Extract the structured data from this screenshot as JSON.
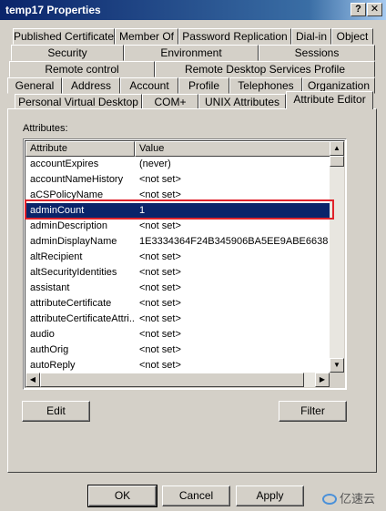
{
  "window": {
    "title": "temp17 Properties",
    "help_label": "?",
    "close_label": "✕"
  },
  "tabs": {
    "row1": [
      "Published Certificates",
      "Member Of",
      "Password Replication",
      "Dial-in",
      "Object"
    ],
    "row2": [
      "Security",
      "Environment",
      "Sessions"
    ],
    "row3": [
      "Remote control",
      "Remote Desktop Services Profile"
    ],
    "row4": [
      "General",
      "Address",
      "Account",
      "Profile",
      "Telephones",
      "Organization"
    ],
    "row5": [
      "Personal Virtual Desktop",
      "COM+",
      "UNIX Attributes",
      "Attribute Editor"
    ]
  },
  "attributes_label": "Attributes:",
  "list": {
    "col_attribute": "Attribute",
    "col_value": "Value",
    "rows": [
      {
        "name": "accountExpires",
        "value": "(never)"
      },
      {
        "name": "accountNameHistory",
        "value": "<not set>"
      },
      {
        "name": "aCSPolicyName",
        "value": "<not set>"
      },
      {
        "name": "adminCount",
        "value": "1"
      },
      {
        "name": "adminDescription",
        "value": "<not set>"
      },
      {
        "name": "adminDisplayName",
        "value": "1E3334364F24B345906BA5EE9ABE6638"
      },
      {
        "name": "altRecipient",
        "value": "<not set>"
      },
      {
        "name": "altSecurityIdentities",
        "value": "<not set>"
      },
      {
        "name": "assistant",
        "value": "<not set>"
      },
      {
        "name": "attributeCertificate",
        "value": "<not set>"
      },
      {
        "name": "attributeCertificateAttri...",
        "value": "<not set>"
      },
      {
        "name": "audio",
        "value": "<not set>"
      },
      {
        "name": "authOrig",
        "value": "<not set>"
      },
      {
        "name": "autoReply",
        "value": "<not set>"
      }
    ],
    "selected_index": 3
  },
  "buttons": {
    "edit": "Edit",
    "filter": "Filter",
    "ok": "OK",
    "cancel": "Cancel",
    "apply": "Apply"
  },
  "watermark": "亿速云",
  "colors": {
    "selection": "#0a246a",
    "highlight_box": "#e0232b",
    "titlebar": "#0a246a"
  }
}
